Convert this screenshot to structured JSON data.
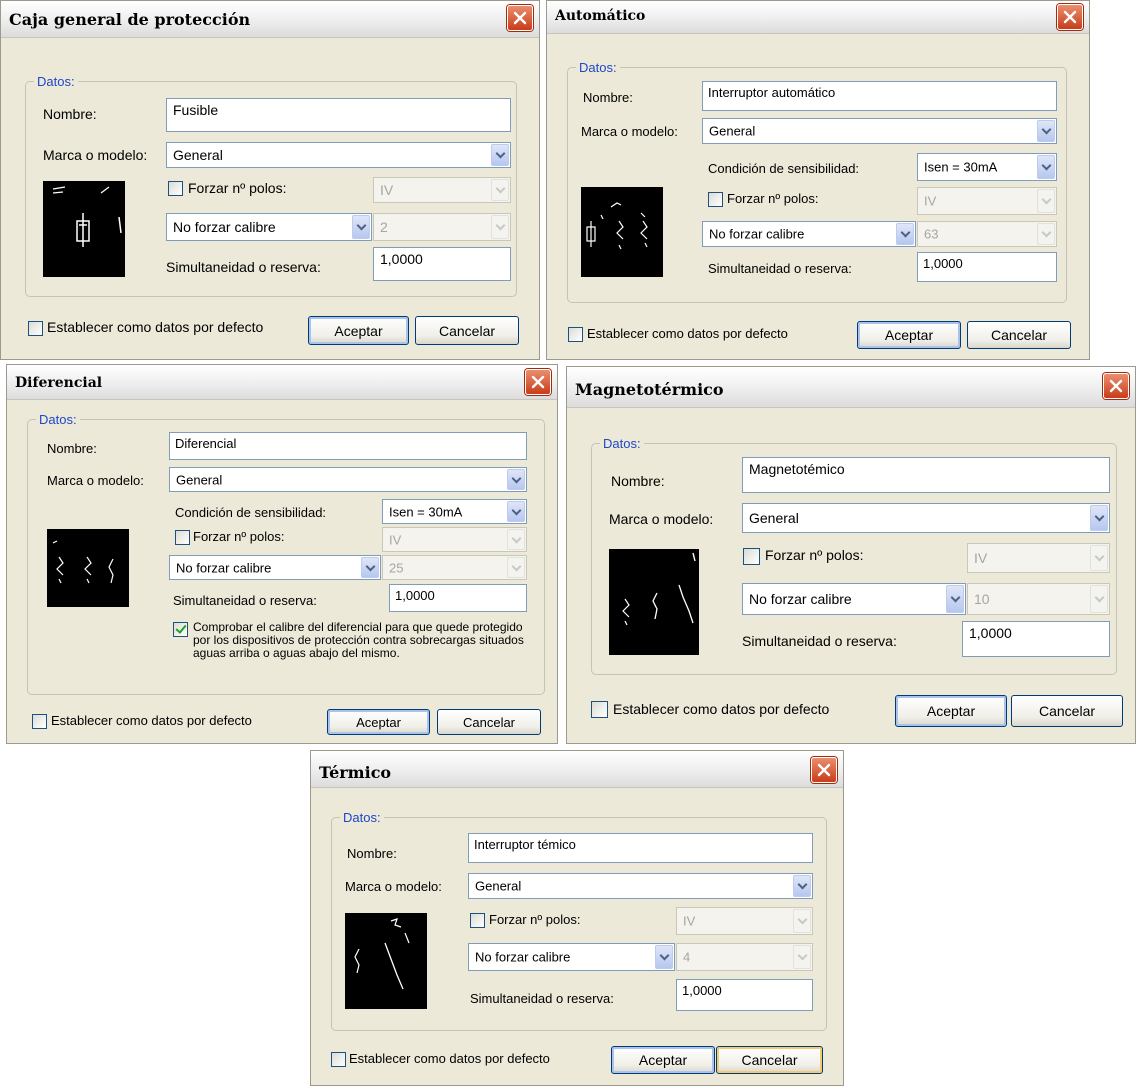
{
  "colors": {
    "legend": "#1f47c8",
    "dialog_bg": "#ece9d8",
    "close": "#c93c19",
    "check": "#21a121"
  },
  "icons": {
    "close": "close-x-icon",
    "dropdown": "chevron-down-icon",
    "preview": "circuit-symbol-preview"
  },
  "common": {
    "legend": "Datos:",
    "nombre_label": "Nombre:",
    "marca_label": "Marca o modelo:",
    "marca_value": "General",
    "forzar_polos_label": "Forzar nº polos:",
    "polos_value": "IV",
    "calibre_value": "No forzar calibre",
    "simultaneidad_label": "Simultaneidad o reserva:",
    "simultaneidad_value": "1,0000",
    "sensibilidad_label": "Condición de sensibilidad:",
    "sensibilidad_value": "Isen = 30mA",
    "defecto_label": "Establecer como datos por defecto",
    "aceptar": "Aceptar",
    "cancelar": "Cancelar"
  },
  "dialogs": {
    "caja": {
      "title": "Caja general de protección",
      "nombre": "Fusible",
      "calibre_num": "2"
    },
    "automatico": {
      "title": "Automático",
      "nombre": "Interruptor automático",
      "calibre_num": "63"
    },
    "diferencial": {
      "title": "Diferencial",
      "nombre": "Diferencial",
      "calibre_num": "25",
      "comprobar_text": "Comprobar el calibre del diferencial para que quede protegido por los dispositivos de protección contra sobrecargas situados aguas arriba o aguas abajo del mismo."
    },
    "magnetotermico": {
      "title": "Magnetotérmico",
      "nombre": "Magnetotémico",
      "calibre_num": "10"
    },
    "termico": {
      "title": "Térmico",
      "nombre": "Interruptor témico",
      "calibre_num": "4"
    }
  }
}
